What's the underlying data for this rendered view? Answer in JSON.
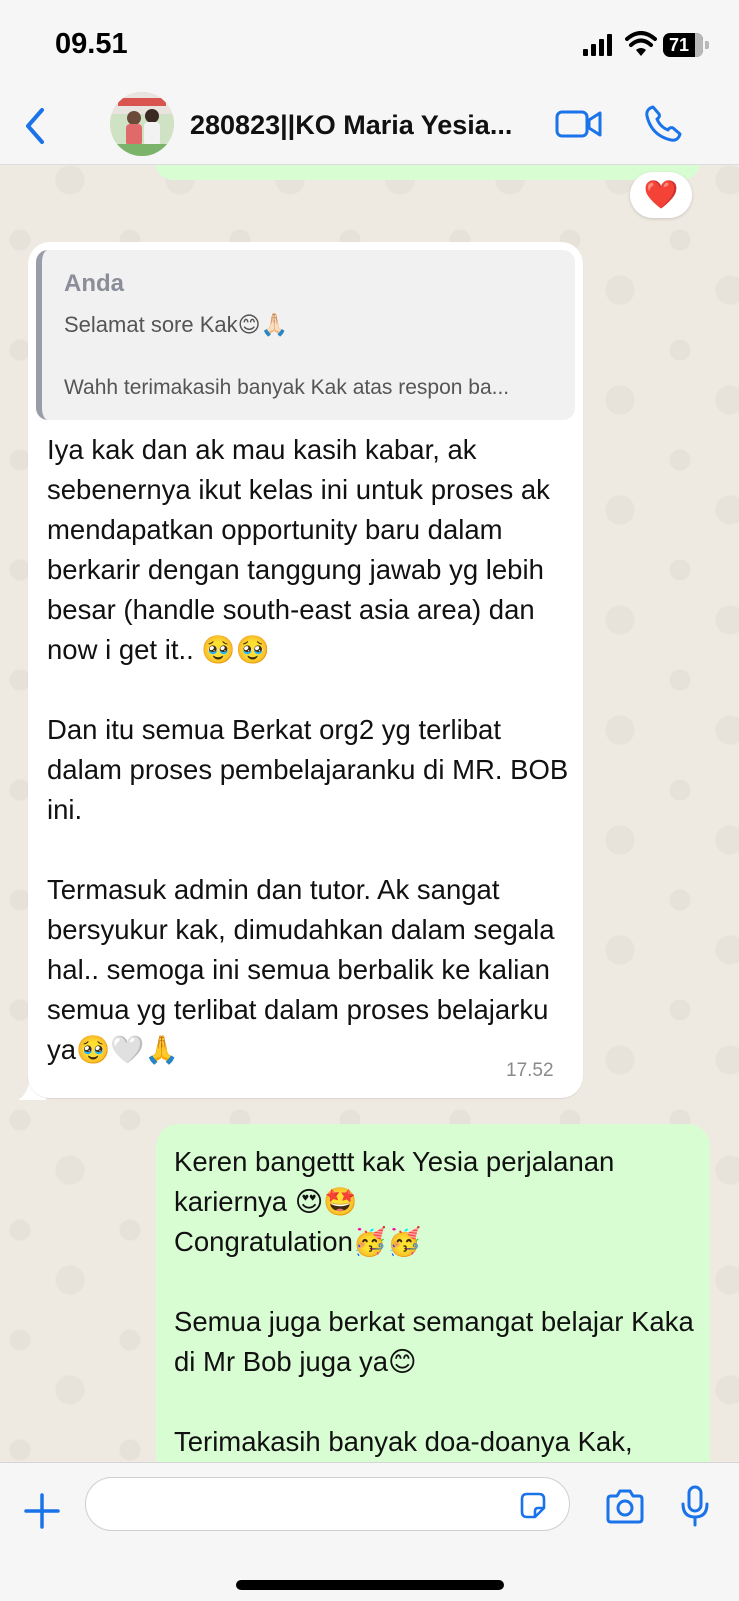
{
  "status_bar": {
    "time": "09.51",
    "battery": "71",
    "battery_level_percent": 71
  },
  "header": {
    "title": "280823||KO Maria Yesia..."
  },
  "previous_message": {
    "reaction": "❤️"
  },
  "incoming_message": {
    "quote": {
      "author": "Anda",
      "line1": "Selamat sore Kak😊🙏🏻",
      "line2": "Wahh terimakasih banyak Kak atas respon ba..."
    },
    "text": "Iya kak dan ak mau kasih kabar, ak sebenernya ikut kelas ini untuk proses ak mendapatkan opportunity baru dalam berkarir dengan tanggung jawab yg lebih besar (handle south-east asia area) dan now i get it.. 🥹🥹\n\nDan itu semua Berkat org2 yg terlibat dalam proses pembelajaranku di MR. BOB ini.\n\nTermasuk admin dan tutor. Ak sangat bersyukur kak, dimudahkan dalam segala hal.. semoga ini semua berbalik ke kalian semua yg terlibat dalam proses belajarku ya🥹🤍🙏",
    "time": "17.52"
  },
  "outgoing_message": {
    "text": "Keren bangettt kak Yesia perjalanan kariernya 😍🤩\nCongratulation🥳🥳\n\nSemua juga berkat semangat belajar Kaka di Mr Bob juga ya😊\n\nTerimakasih banyak doa-doanya Kak,"
  },
  "input": {
    "placeholder": "",
    "value": ""
  }
}
